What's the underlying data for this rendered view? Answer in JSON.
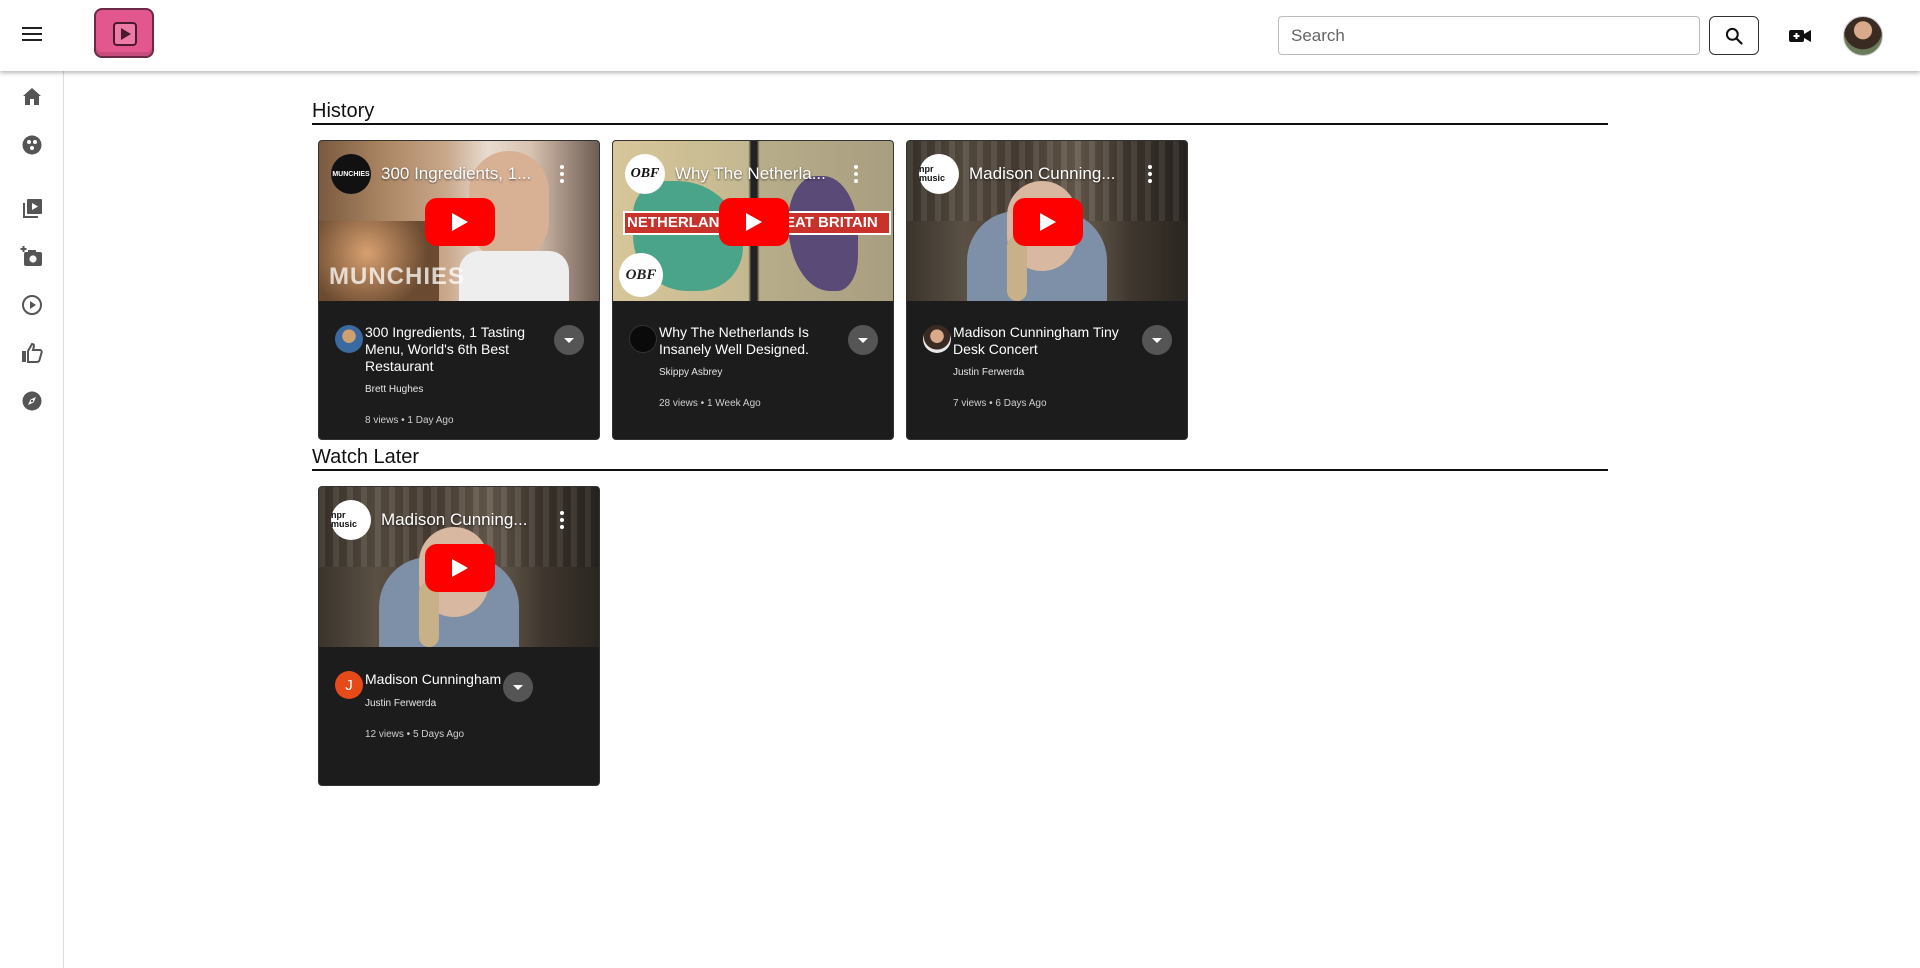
{
  "header": {
    "search_placeholder": "Search",
    "icons": [
      "menu-icon",
      "app-logo",
      "search-icon",
      "video-camera-icon",
      "user-avatar"
    ]
  },
  "sidebar": {
    "icons": [
      "home-icon",
      "subscriptions-icon",
      "library-icon",
      "add-photo-icon",
      "play-circle-icon",
      "thumb-up-icon",
      "explore-icon"
    ]
  },
  "sections": {
    "history": {
      "title": "History",
      "videos": [
        {
          "thumb_title": "300 Ingredients, 1...",
          "title": "300 Ingredients, 1 Tasting Menu, World's 6th Best Restaurant",
          "channel": "Brett Hughes",
          "stats": "8 views • 1 Day Ago",
          "thumb_channel_text": "MUNCHIES",
          "thumb_overlay": "MUNCHIES"
        },
        {
          "thumb_title": "Why The Netherla...",
          "title": "Why The Netherlands Is Insanely Well Designed.",
          "channel": "Skippy Asbrey",
          "stats": "28 views • 1 Week Ago",
          "thumb_channel_text": "OBF",
          "thumb_overlay_left": "NETHERLAN",
          "thumb_overlay_right": "EAT BRITAIN",
          "thumb_corner": "OBF"
        },
        {
          "thumb_title": "Madison Cunning...",
          "title": "Madison Cunningham Tiny Desk Concert",
          "channel": "Justin Ferwerda",
          "stats": "7 views • 6 Days Ago",
          "thumb_channel_text": "npr music"
        }
      ]
    },
    "watch_later": {
      "title": "Watch Later",
      "videos": [
        {
          "thumb_title": "Madison Cunning...",
          "title": "Madison Cunningham",
          "channel": "Justin Ferwerda",
          "stats": "12 views • 5 Days Ago",
          "thumb_channel_text": "npr music",
          "avatar_letter": "J"
        }
      ]
    }
  },
  "colors": {
    "card_bg": "#1c1c1c",
    "play_red": "#ff0000",
    "logo_pink": "#e2588e",
    "avatar_red": "#e64a19"
  }
}
